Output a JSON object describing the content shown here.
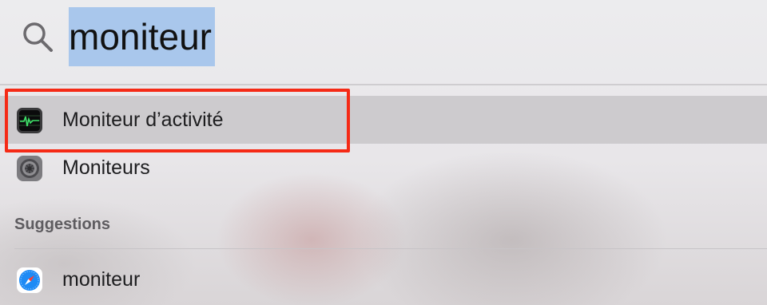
{
  "search": {
    "query": "moniteur",
    "icon": "search-icon"
  },
  "results": [
    {
      "label": "Moniteur d’activité",
      "icon": "activity-monitor-icon",
      "selected": true
    },
    {
      "label": "Moniteurs",
      "icon": "system-settings-icon",
      "selected": false
    }
  ],
  "suggestions": {
    "header": "Suggestions",
    "items": [
      {
        "label": "moniteur",
        "icon": "safari-icon"
      }
    ]
  },
  "colors": {
    "selection_highlight": "#a9c7ec",
    "annotation_border": "#f52a16"
  }
}
